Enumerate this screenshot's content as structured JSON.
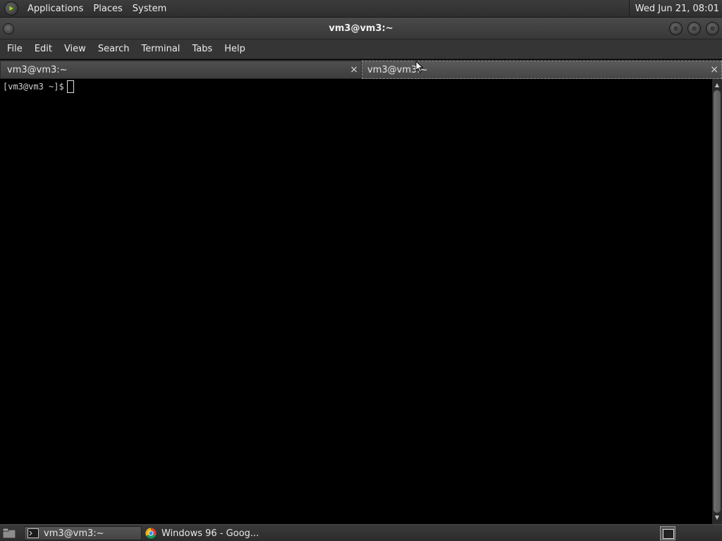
{
  "top_panel": {
    "menus": [
      "Applications",
      "Places",
      "System"
    ],
    "clock": "Wed Jun 21, 08:01"
  },
  "window": {
    "title": "vm3@vm3:~"
  },
  "menubar": {
    "items": [
      "File",
      "Edit",
      "View",
      "Search",
      "Terminal",
      "Tabs",
      "Help"
    ]
  },
  "tabs": [
    {
      "label": "vm3@vm3:~",
      "close": "×"
    },
    {
      "label": "vm3@vm3:~",
      "close": "×"
    }
  ],
  "terminal": {
    "prompt": "[vm3@vm3 ~]$"
  },
  "taskbar": {
    "tasks": [
      {
        "label": "vm3@vm3:~",
        "icon": "terminal-icon"
      },
      {
        "label": "Windows 96 - Goog...",
        "icon": "chrome-icon"
      }
    ]
  },
  "colors": {
    "panel": "#353535",
    "terminal_bg": "#000000",
    "text": "#ececec"
  }
}
